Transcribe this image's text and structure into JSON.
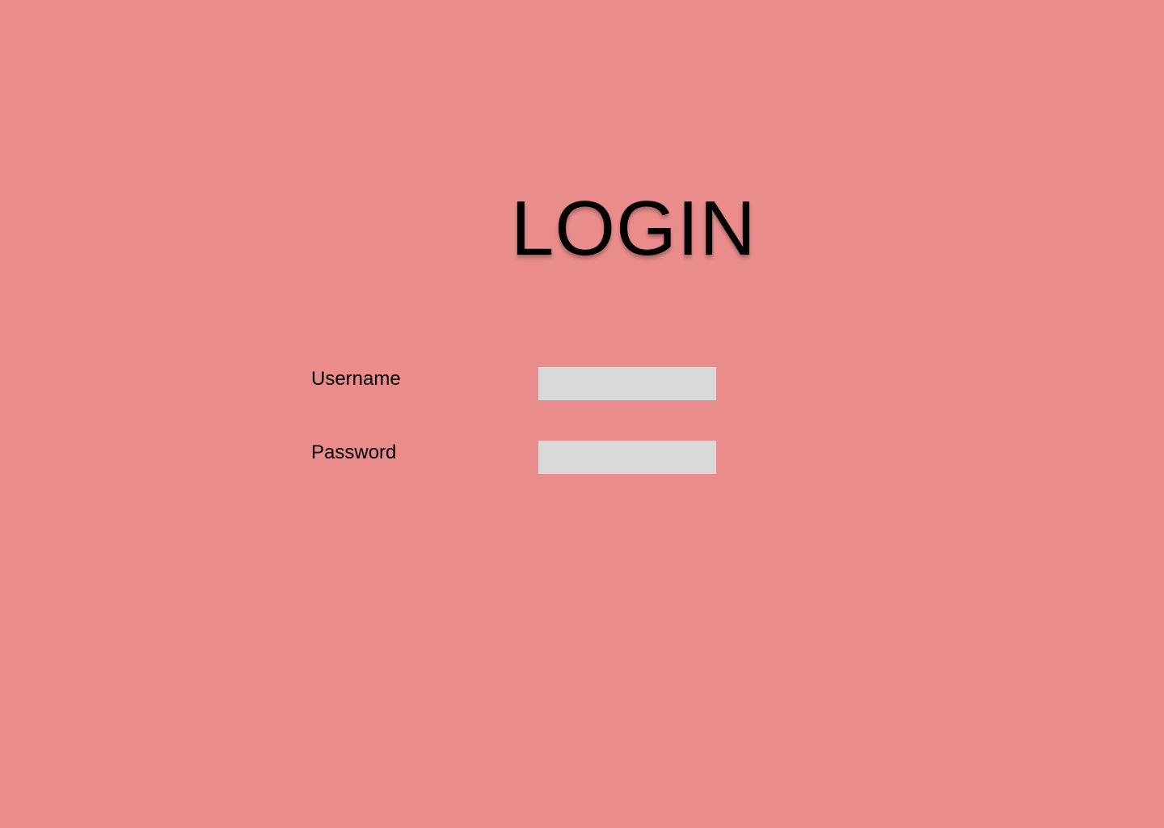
{
  "page": {
    "title": "LOGIN",
    "background_color": "#E98C8B"
  },
  "form": {
    "username": {
      "label": "Username",
      "value": "",
      "placeholder": ""
    },
    "password": {
      "label": "Password",
      "value": "",
      "placeholder": ""
    },
    "input_background_color": "#D9D9D9"
  }
}
